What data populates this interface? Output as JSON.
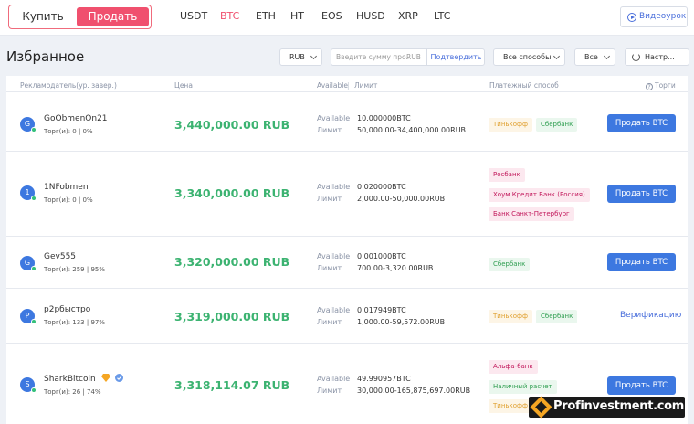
{
  "topbar": {
    "buy_label": "Купить",
    "sell_label": "Продать",
    "coins": [
      "USDT",
      "BTC",
      "ETH",
      "HT",
      "EOS",
      "HUSD",
      "XRP",
      "LTC"
    ],
    "active_coin": "BTC",
    "video_label": "Видеоурок"
  },
  "filters": {
    "title": "Избранное",
    "currency": "RUB",
    "amount_placeholder": "Введите сумму про...",
    "amount_currency": "RUB",
    "confirm_label": "Подтвердить",
    "payment_method": "Все способы",
    "all": "Все",
    "settings": "Настр..."
  },
  "table": {
    "headers": {
      "advertiser": "Рекламодатель(ур. завер.)",
      "price": "Цена",
      "available": "Available",
      "limit": "Лимит",
      "payment": "Платежный способ",
      "trades": "Торги"
    },
    "labels": {
      "available": "Available",
      "limit": "Лимит"
    },
    "sell_button": "Продать BTC",
    "verify_link": "Верификацию",
    "rows": [
      {
        "avatar": "G",
        "name": "GoObmenOn21",
        "trades": "Торг(и): 0 | 0%",
        "price": "3,440,000.00 RUB",
        "available": "10.000000BTC",
        "limit": "50,000.00-34,400,000.00RUB",
        "payments": [
          {
            "label": "Тинькофф",
            "color": "#e0a030",
            "bg": "#fdf5e6"
          },
          {
            "label": "Сбербанк",
            "color": "#2e9e50",
            "bg": "#eaf7ee"
          }
        ]
      },
      {
        "avatar": "1",
        "name": "1NFobmen",
        "trades": "Торг(и): 0 | 0%",
        "price": "3,340,000.00 RUB",
        "available": "0.020000BTC",
        "limit": "2,000.00-50,000.00RUB",
        "payments": [
          {
            "label": "Росбанк",
            "color": "#c2185b",
            "bg": "#fce8ef"
          },
          {
            "label": "Хоум Кредит Банк (Россия)",
            "color": "#c2185b",
            "bg": "#fce8ef"
          },
          {
            "label": "Банк Санкт-Петербург",
            "color": "#c2185b",
            "bg": "#fce8ef"
          }
        ]
      },
      {
        "avatar": "G",
        "name": "Gev555",
        "trades": "Торг(и): 259 | 95%",
        "price": "3,320,000.00 RUB",
        "available": "0.001000BTC",
        "limit": "700.00-3,320.00RUB",
        "payments": [
          {
            "label": "Сбербанк",
            "color": "#2e9e50",
            "bg": "#eaf7ee"
          }
        ]
      },
      {
        "avatar": "P",
        "name": "p2pбыстро",
        "trades": "Торг(и): 133 | 97%",
        "price": "3,319,000.00 RUB",
        "available": "0.017949BTC",
        "limit": "1,000.00-59,572.00RUB",
        "payments": [
          {
            "label": "Тинькофф",
            "color": "#e0a030",
            "bg": "#fdf5e6"
          },
          {
            "label": "Сбербанк",
            "color": "#2e9e50",
            "bg": "#eaf7ee"
          }
        ]
      },
      {
        "avatar": "S",
        "name": "SharkBitcoin",
        "trades": "Торг(и): 26 | 74%",
        "price": "3,318,114.07 RUB",
        "available": "49.990957BTC",
        "limit": "30,000.00-165,875,697.00RUB",
        "payments": [
          {
            "label": "Альфа-банк",
            "color": "#c2185b",
            "bg": "#fce8ef"
          },
          {
            "label": "Наличный расчет",
            "color": "#2e9e50",
            "bg": "#eaf7ee"
          },
          {
            "label": "Тинькофф",
            "color": "#e0a030",
            "bg": "#fdf5e6"
          }
        ]
      }
    ]
  },
  "watermark": {
    "text": "Profinvestment.com"
  }
}
